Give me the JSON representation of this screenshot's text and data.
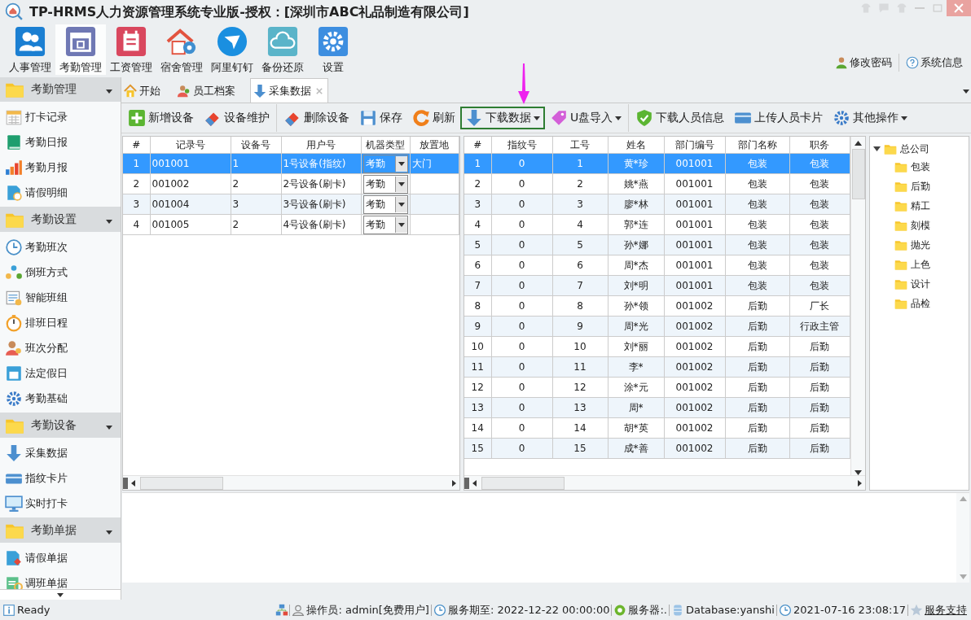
{
  "window": {
    "title": "TP-HRMS人力资源管理系统专业版-授权：[深圳市ABC礼品制造有限公司]"
  },
  "modules": [
    {
      "label": "人事管理",
      "selected": false
    },
    {
      "label": "考勤管理",
      "selected": true
    },
    {
      "label": "工资管理",
      "selected": false
    },
    {
      "label": "宿舍管理",
      "selected": false
    },
    {
      "label": "阿里钉钉",
      "selected": false
    },
    {
      "label": "备份还原",
      "selected": false
    },
    {
      "label": "设置",
      "selected": false
    }
  ],
  "header_links": [
    {
      "label": "修改密码"
    },
    {
      "label": "系统信息"
    }
  ],
  "sidebar": {
    "groups": [
      {
        "label": "考勤管理",
        "items": [
          {
            "label": "打卡记录",
            "selected": false
          },
          {
            "label": "考勤日报",
            "selected": false
          },
          {
            "label": "考勤月报",
            "selected": false
          },
          {
            "label": "请假明细",
            "selected": false
          }
        ]
      },
      {
        "label": "考勤设置",
        "items": [
          {
            "label": "考勤班次",
            "selected": false
          },
          {
            "label": "倒班方式",
            "selected": false
          },
          {
            "label": "智能班组",
            "selected": false
          },
          {
            "label": "排班日程",
            "selected": false
          },
          {
            "label": "班次分配",
            "selected": false
          },
          {
            "label": "法定假日",
            "selected": false
          },
          {
            "label": "考勤基础",
            "selected": false
          }
        ]
      },
      {
        "label": "考勤设备",
        "items": [
          {
            "label": "采集数据",
            "selected": false
          },
          {
            "label": "指纹卡片",
            "selected": false
          },
          {
            "label": "实时打卡",
            "selected": false
          }
        ]
      },
      {
        "label": "考勤单据",
        "items": [
          {
            "label": "请假单据",
            "selected": false
          },
          {
            "label": "调班单据",
            "selected": false
          }
        ]
      }
    ]
  },
  "tabs": [
    {
      "label": "开始",
      "selected": false,
      "closable": false
    },
    {
      "label": "员工档案",
      "selected": false,
      "closable": false
    },
    {
      "label": "采集数据",
      "selected": true,
      "closable": true
    }
  ],
  "toolbar": [
    {
      "kind": "button",
      "label": "新增设备",
      "highlighted": false
    },
    {
      "kind": "button",
      "label": "设备维护",
      "highlighted": false
    },
    {
      "kind": "separator"
    },
    {
      "kind": "button",
      "label": "删除设备",
      "highlighted": false
    },
    {
      "kind": "button",
      "label": "保存",
      "highlighted": false
    },
    {
      "kind": "button",
      "label": "刷新",
      "highlighted": false
    },
    {
      "kind": "dropdown",
      "label": "下载数据",
      "highlighted": true
    },
    {
      "kind": "dropdown",
      "label": "U盘导入",
      "highlighted": false
    },
    {
      "kind": "separator"
    },
    {
      "kind": "button",
      "label": "下载人员信息",
      "highlighted": false
    },
    {
      "kind": "button",
      "label": "上传人员卡片",
      "highlighted": false
    },
    {
      "kind": "dropdown",
      "label": "其他操作",
      "highlighted": false
    }
  ],
  "device_table": {
    "columns": [
      {
        "label": "#",
        "kind": "text"
      },
      {
        "label": "记录号",
        "kind": "text"
      },
      {
        "label": "设备号",
        "kind": "text"
      },
      {
        "label": "用户号",
        "kind": "text"
      },
      {
        "label": "机器类型",
        "kind": "combo"
      },
      {
        "label": "放置地",
        "kind": "text"
      }
    ],
    "rows": [
      {
        "selected": true,
        "cells": [
          "1",
          "001001",
          "1",
          "1号设备(指纹)",
          "考勤",
          "大门"
        ]
      },
      {
        "selected": false,
        "cells": [
          "2",
          "001002",
          "2",
          "2号设备(刷卡)",
          "考勤"
        ]
      },
      {
        "selected": false,
        "cells": [
          "3",
          "001004",
          "3",
          "3号设备(刷卡)",
          "考勤"
        ]
      },
      {
        "selected": false,
        "cells": [
          "4",
          "001005",
          "2",
          "4号设备(刷卡)",
          "考勤"
        ]
      }
    ]
  },
  "staff_table": {
    "columns": [
      "#",
      "指纹号",
      "工号",
      "姓名",
      "部门编号",
      "部门名称",
      "职务"
    ],
    "rows": [
      {
        "selected": true,
        "cells": [
          "1",
          "0",
          "1",
          "黄*珍",
          "001001",
          "包装",
          "包装"
        ]
      },
      {
        "selected": false,
        "cells": [
          "2",
          "0",
          "2",
          "姚*燕",
          "001001",
          "包装",
          "包装"
        ]
      },
      {
        "selected": false,
        "cells": [
          "3",
          "0",
          "3",
          "廖*林",
          "001001",
          "包装",
          "包装"
        ]
      },
      {
        "selected": false,
        "cells": [
          "4",
          "0",
          "4",
          "郭*连",
          "001001",
          "包装",
          "包装"
        ]
      },
      {
        "selected": false,
        "cells": [
          "5",
          "0",
          "5",
          "孙*娜",
          "001001",
          "包装",
          "包装"
        ]
      },
      {
        "selected": false,
        "cells": [
          "6",
          "0",
          "6",
          "周*杰",
          "001001",
          "包装",
          "包装"
        ]
      },
      {
        "selected": false,
        "cells": [
          "7",
          "0",
          "7",
          "刘*明",
          "001001",
          "包装",
          "包装"
        ]
      },
      {
        "selected": false,
        "cells": [
          "8",
          "0",
          "8",
          "孙*领",
          "001002",
          "后勤",
          "厂长"
        ]
      },
      {
        "selected": false,
        "cells": [
          "9",
          "0",
          "9",
          "周*光",
          "001002",
          "后勤",
          "行政主管"
        ]
      },
      {
        "selected": false,
        "cells": [
          "10",
          "0",
          "10",
          "刘*丽",
          "001002",
          "后勤",
          "后勤"
        ]
      },
      {
        "selected": false,
        "cells": [
          "11",
          "0",
          "11",
          "李*",
          "001002",
          "后勤",
          "后勤"
        ]
      },
      {
        "selected": false,
        "cells": [
          "12",
          "0",
          "12",
          "涂*元",
          "001002",
          "后勤",
          "后勤"
        ]
      },
      {
        "selected": false,
        "cells": [
          "13",
          "0",
          "13",
          "周*",
          "001002",
          "后勤",
          "后勤"
        ]
      },
      {
        "selected": false,
        "cells": [
          "14",
          "0",
          "14",
          "胡*英",
          "001002",
          "后勤",
          "后勤"
        ]
      },
      {
        "selected": false,
        "cells": [
          "15",
          "0",
          "15",
          "成*善",
          "001002",
          "后勤",
          "后勤"
        ]
      }
    ]
  },
  "tree": {
    "label": "总公司",
    "expanded": true,
    "children": [
      {
        "label": "包装"
      },
      {
        "label": "后勤"
      },
      {
        "label": "精工"
      },
      {
        "label": "刻模"
      },
      {
        "label": "抛光"
      },
      {
        "label": "上色"
      },
      {
        "label": "设计"
      },
      {
        "label": "品检"
      }
    ]
  },
  "status_bar": {
    "status": "Ready",
    "items": [
      {
        "kind": "text",
        "text": "操作员: admin[免费用户]"
      },
      {
        "kind": "text",
        "text": "服务期至: 2022-12-22 00:00:00"
      },
      {
        "kind": "text",
        "text": "服务器:."
      },
      {
        "kind": "text",
        "text": "Database:yanshi"
      },
      {
        "kind": "text",
        "text": "2021-07-16 23:08:17"
      },
      {
        "kind": "link",
        "text": "服务支持"
      }
    ]
  }
}
